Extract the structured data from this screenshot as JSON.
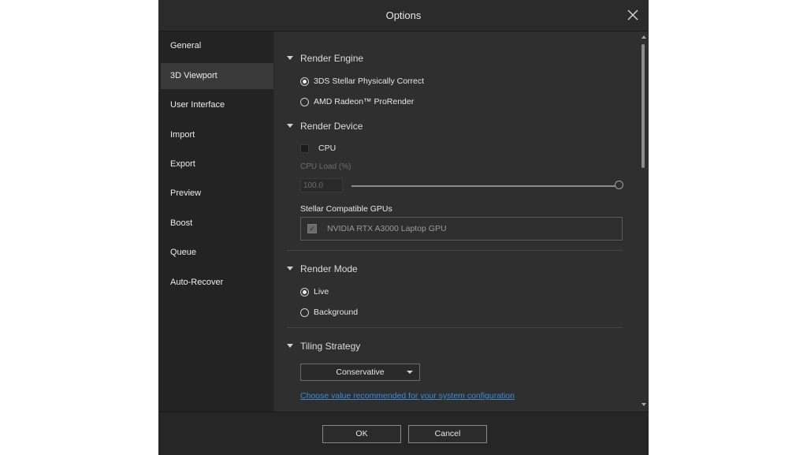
{
  "dialog": {
    "title": "Options"
  },
  "sidebar": {
    "items": [
      {
        "label": "General"
      },
      {
        "label": "3D Viewport"
      },
      {
        "label": "User Interface"
      },
      {
        "label": "Import"
      },
      {
        "label": "Export"
      },
      {
        "label": "Preview"
      },
      {
        "label": "Boost"
      },
      {
        "label": "Queue"
      },
      {
        "label": "Auto-Recover"
      }
    ],
    "active_index": 1
  },
  "render_engine": {
    "heading": "Render Engine",
    "options": [
      "3DS Stellar Physically Correct",
      "AMD Radeon™ ProRender"
    ],
    "selected": "3DS Stellar Physically Correct"
  },
  "render_device": {
    "heading": "Render Device",
    "cpu_label": "CPU",
    "cpu_checked": false,
    "cpu_load_label": "CPU Load (%)",
    "cpu_load_value": "100.0",
    "cpu_load_slider_fraction": 1.0,
    "gpus_heading": "Stellar Compatible GPUs",
    "gpus": [
      {
        "label": "NVIDIA RTX A3000 Laptop GPU",
        "checked": true
      }
    ]
  },
  "render_mode": {
    "heading": "Render Mode",
    "options": [
      "Live",
      "Background"
    ],
    "selected": "Live"
  },
  "tiling_strategy": {
    "heading": "Tiling Strategy",
    "value": "Conservative",
    "link": "Choose value recommended for your system configuration"
  },
  "footer": {
    "ok_label": "OK",
    "cancel_label": "Cancel"
  },
  "colors": {
    "accent_link": "#3d8bd8",
    "dialog_bg": "#2b2b2b",
    "content_bg": "#2f2f2f"
  }
}
